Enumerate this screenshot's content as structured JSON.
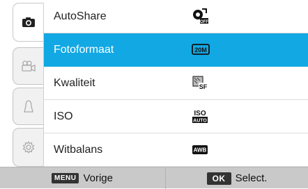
{
  "tabs": [
    {
      "icon": "camera-icon",
      "active": true
    },
    {
      "icon": "video-camera-icon",
      "active": false
    },
    {
      "icon": "user-icon",
      "active": false
    },
    {
      "icon": "gear-icon",
      "active": false
    }
  ],
  "menu": {
    "items": [
      {
        "label": "AutoShare",
        "icon": "autoshare-off-icon",
        "selected": false
      },
      {
        "label": "Fotoformaat",
        "icon": "photo-size-20m-icon",
        "icon_text": "20M",
        "selected": true
      },
      {
        "label": "Kwaliteit",
        "icon": "quality-superfine-icon",
        "icon_text": "SF",
        "selected": false
      },
      {
        "label": "ISO",
        "icon": "iso-auto-icon",
        "icon_text": "ISO",
        "icon_subtext": "AUTO",
        "selected": false
      },
      {
        "label": "Witbalans",
        "icon": "white-balance-auto-icon",
        "icon_text": "AWB",
        "selected": false
      }
    ]
  },
  "bottom_bar": {
    "left_key": "MENU",
    "left_label": "Vorige",
    "right_key": "OK",
    "right_label": "Select."
  },
  "colors": {
    "selected_row": "#12a8e3",
    "bottom_bar": "#c9c9c9"
  }
}
